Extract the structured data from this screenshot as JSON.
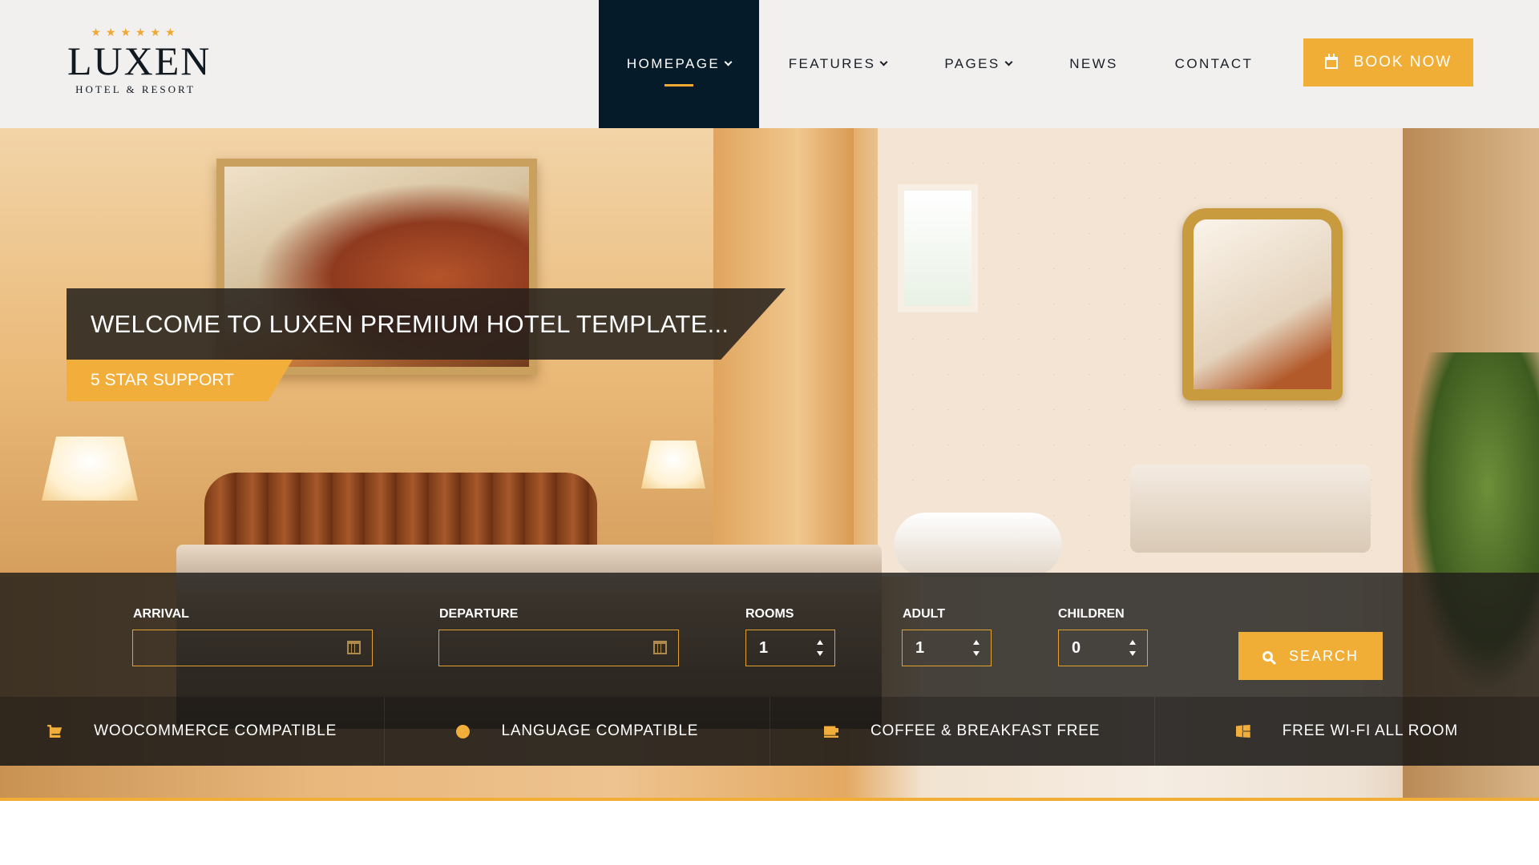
{
  "logo": {
    "stars": "★★★★★★",
    "name": "LUXEN",
    "subtitle": "HOTEL & RESORT"
  },
  "nav": {
    "items": [
      {
        "label": "HOMEPAGE",
        "dropdown": true,
        "active": true
      },
      {
        "label": "FEATURES",
        "dropdown": true,
        "active": false
      },
      {
        "label": "PAGES",
        "dropdown": true,
        "active": false
      },
      {
        "label": "NEWS",
        "dropdown": false,
        "active": false
      },
      {
        "label": "CONTACT",
        "dropdown": false,
        "active": false
      }
    ],
    "book_label": "BOOK NOW"
  },
  "hero": {
    "headline": "WELCOME TO LUXEN PREMIUM HOTEL TEMPLATE...",
    "tagline": "5 STAR SUPPORT"
  },
  "booking": {
    "arrival_label": "ARRIVAL",
    "arrival_value": "",
    "departure_label": "DEPARTURE",
    "departure_value": "",
    "rooms_label": "ROOMS",
    "rooms_value": "1",
    "adult_label": "ADULT",
    "adult_value": "1",
    "children_label": "CHILDREN",
    "children_value": "0",
    "search_label": "SEARCH"
  },
  "features": [
    {
      "icon": "cart-icon",
      "label": "WOOCOMMERCE COMPATIBLE"
    },
    {
      "icon": "globe-icon",
      "label": "LANGUAGE COMPATIBLE"
    },
    {
      "icon": "coffee-icon",
      "label": "COFFEE & BREAKFAST FREE"
    },
    {
      "icon": "windows-icon",
      "label": "FREE WI-FI ALL ROOM"
    }
  ],
  "colors": {
    "accent": "#f0ae36",
    "nav_active_bg": "#051b29",
    "header_bg": "#f1f0ef"
  }
}
